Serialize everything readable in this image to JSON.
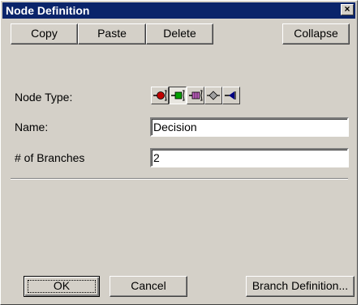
{
  "window": {
    "title": "Node Definition",
    "close_glyph": "×"
  },
  "toolbar": {
    "copy": "Copy",
    "paste": "Paste",
    "delete": "Delete",
    "collapse": "Collapse"
  },
  "node_type": {
    "label": "Node Type:",
    "icons": [
      {
        "name": "chance-node-icon",
        "color": "#c00000",
        "selected": false
      },
      {
        "name": "decision-node-icon",
        "color": "#00a000",
        "selected": true
      },
      {
        "name": "utility-node-icon",
        "color": "#c060c0",
        "selected": false
      },
      {
        "name": "logic-node-icon",
        "color": "#808080",
        "selected": false
      },
      {
        "name": "terminal-node-icon",
        "color": "#000080",
        "selected": false
      }
    ]
  },
  "name": {
    "label": "Name:",
    "value": "Decision"
  },
  "branches": {
    "label": "# of Branches",
    "value": "2"
  },
  "footer": {
    "ok": "OK",
    "cancel": "Cancel",
    "branch_definition": "Branch Definition..."
  }
}
